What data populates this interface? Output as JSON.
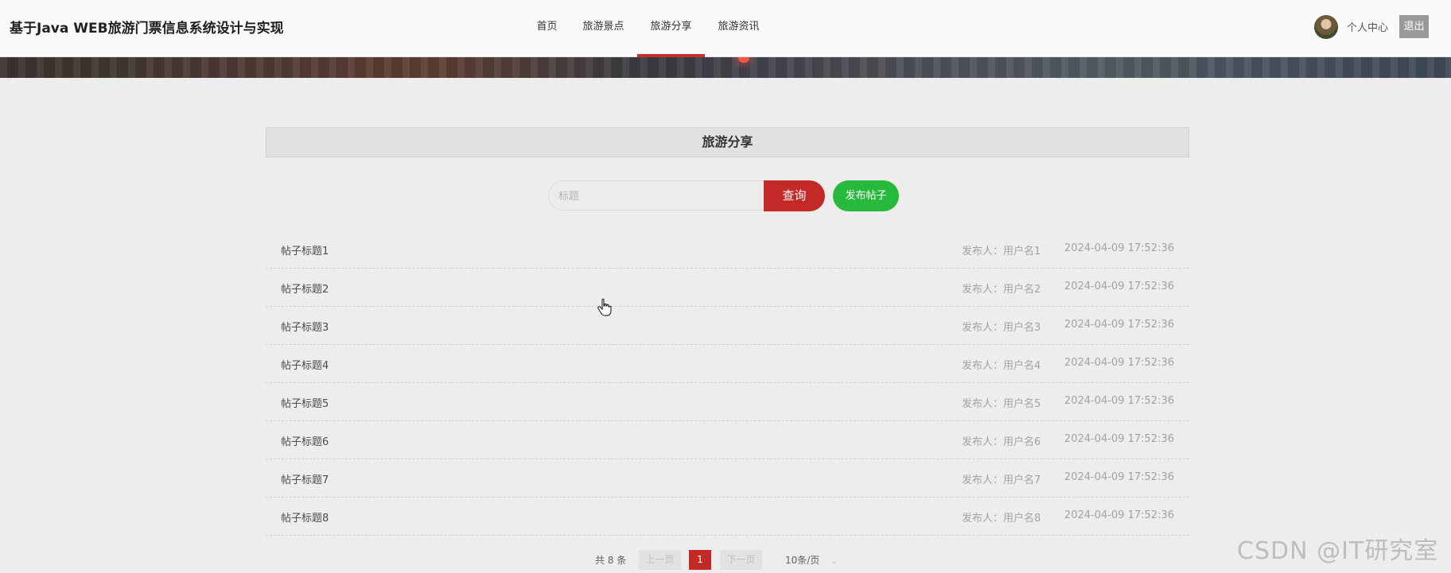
{
  "header": {
    "site_title": "基于Java WEB旅游门票信息系统设计与实现",
    "nav": [
      {
        "label": "首页",
        "active": false
      },
      {
        "label": "旅游景点",
        "active": false
      },
      {
        "label": "旅游分享",
        "active": true
      },
      {
        "label": "旅游资讯",
        "active": false
      }
    ],
    "user_center_label": "个人中心",
    "logout_label": "退出"
  },
  "section": {
    "title": "旅游分享",
    "search_placeholder": "标题",
    "query_button": "查询",
    "post_button": "发布帖子"
  },
  "posts": [
    {
      "title": "帖子标题1",
      "author_label": "发布人：",
      "author": "用户名1",
      "time": "2024-04-09 17:52:36"
    },
    {
      "title": "帖子标题2",
      "author_label": "发布人：",
      "author": "用户名2",
      "time": "2024-04-09 17:52:36"
    },
    {
      "title": "帖子标题3",
      "author_label": "发布人：",
      "author": "用户名3",
      "time": "2024-04-09 17:52:36"
    },
    {
      "title": "帖子标题4",
      "author_label": "发布人：",
      "author": "用户名4",
      "time": "2024-04-09 17:52:36"
    },
    {
      "title": "帖子标题5",
      "author_label": "发布人：",
      "author": "用户名5",
      "time": "2024-04-09 17:52:36"
    },
    {
      "title": "帖子标题6",
      "author_label": "发布人：",
      "author": "用户名6",
      "time": "2024-04-09 17:52:36"
    },
    {
      "title": "帖子标题7",
      "author_label": "发布人：",
      "author": "用户名7",
      "time": "2024-04-09 17:52:36"
    },
    {
      "title": "帖子标题8",
      "author_label": "发布人：",
      "author": "用户名8",
      "time": "2024-04-09 17:52:36"
    }
  ],
  "pagination": {
    "total_text": "共 8 条",
    "prev_label": "上一页",
    "current_page": "1",
    "next_label": "下一页",
    "page_size": "10条/页"
  },
  "watermark": "CSDN @IT研究室",
  "colors": {
    "accent_red": "#c32a27",
    "post_green": "#26b93b",
    "background": "#ededed"
  }
}
